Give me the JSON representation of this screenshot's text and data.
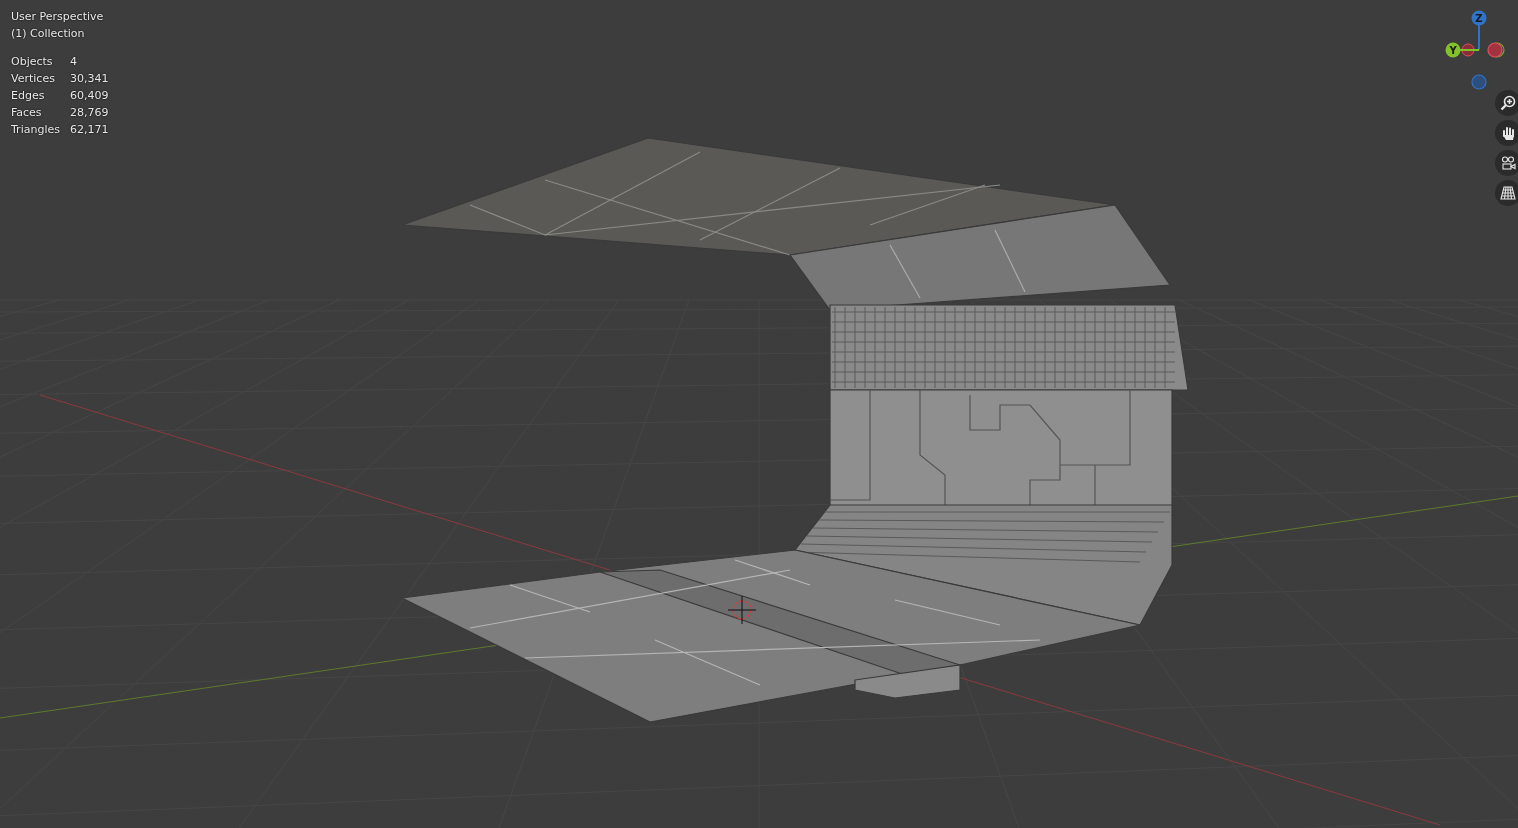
{
  "viewport": {
    "view_name": "User Perspective",
    "collection": "(1) Collection",
    "stats": [
      {
        "label": "Objects",
        "value": "4"
      },
      {
        "label": "Vertices",
        "value": "30,341"
      },
      {
        "label": "Edges",
        "value": "60,409"
      },
      {
        "label": "Faces",
        "value": "28,769"
      },
      {
        "label": "Triangles",
        "value": "62,171"
      }
    ]
  },
  "gizmo": {
    "axes": [
      {
        "label": "Z",
        "color": "#2f74c9"
      },
      {
        "label": "Y",
        "color": "#82c12a"
      }
    ]
  },
  "nav_buttons": [
    {
      "kind": "zoom"
    },
    {
      "kind": "pan"
    },
    {
      "kind": "camera"
    },
    {
      "kind": "ortho"
    }
  ]
}
